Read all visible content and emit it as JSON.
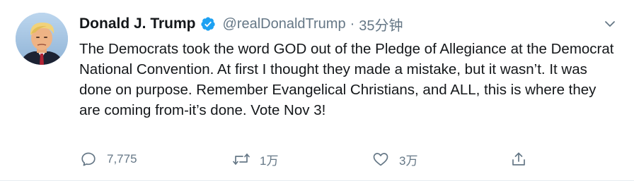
{
  "tweet": {
    "author": {
      "name": "Donald J. Trump",
      "handle": "@realDonaldTrump",
      "verified": true
    },
    "separator": "·",
    "time": "35分钟",
    "text": "The Democrats took the word GOD out of the Pledge of Allegiance at the Democrat National Convention. At first I thought they made a mistake, but it wasn’t. It was done on purpose. Remember Evangelical Christians, and ALL, this is where they are coming from-it’s done. Vote Nov 3!",
    "actions": {
      "reply": {
        "icon": "reply-icon",
        "count": "7,775"
      },
      "retweet": {
        "icon": "retweet-icon",
        "count": "1万"
      },
      "like": {
        "icon": "heart-icon",
        "count": "3万"
      },
      "share": {
        "icon": "share-icon"
      }
    }
  },
  "colors": {
    "text": "#14171a",
    "secondary": "#657786",
    "verified": "#1da1f2",
    "border": "#e6ecf0"
  }
}
